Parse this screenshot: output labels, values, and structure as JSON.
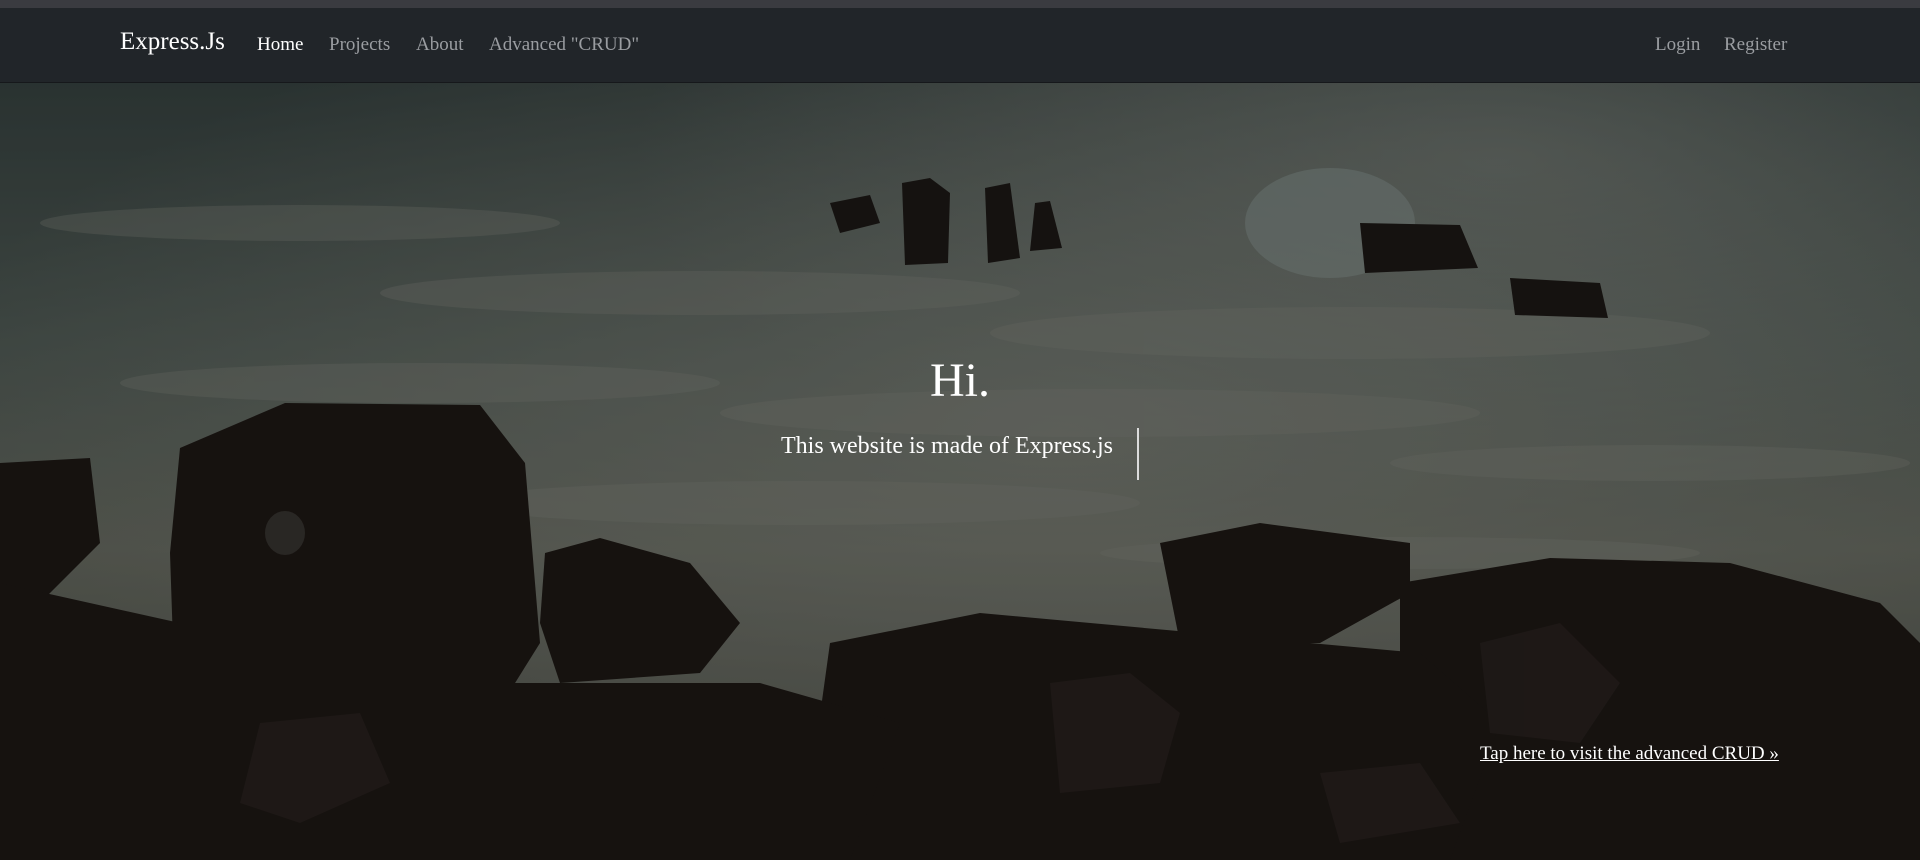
{
  "navbar": {
    "brand": "Express.Js",
    "left_links": [
      {
        "label": "Home",
        "active": true
      },
      {
        "label": "Projects",
        "active": false
      },
      {
        "label": "About",
        "active": false
      },
      {
        "label": "Advanced \"CRUD\"",
        "active": false
      }
    ],
    "right_links": [
      {
        "label": "Login"
      },
      {
        "label": "Register"
      }
    ]
  },
  "hero": {
    "headline": "Hi.",
    "tagline": "This website is made of Express.js",
    "crud_link": "Tap here to visit the advanced CRUD »"
  },
  "colors": {
    "navbar_bg": "#212529",
    "nav_link": "#9a9da1",
    "nav_link_active": "#ffffff",
    "hero_text": "#ffffff"
  }
}
